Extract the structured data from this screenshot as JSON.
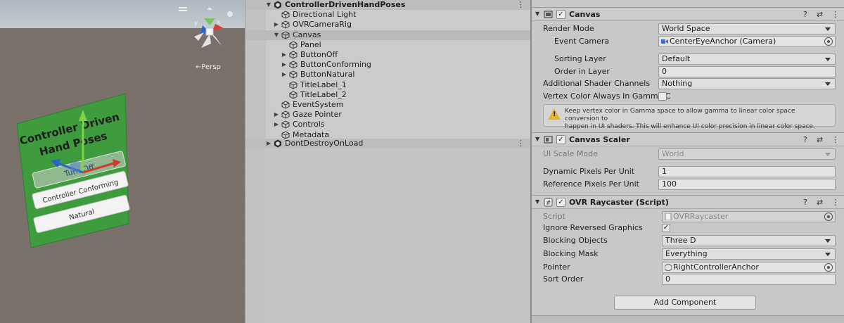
{
  "scene": {
    "persp_label": "←Persp",
    "panel": {
      "title_line1": "Controller Driven",
      "title_line2": "Hand Poses",
      "button_off": "Turn Off",
      "button_conforming": "Controller Conforming",
      "button_natural": "Natural"
    },
    "colors": {
      "ground": "#7a706a",
      "sky": "#b9c2cc",
      "panel": "#3a9a3a"
    }
  },
  "hierarchy": {
    "items": [
      {
        "label": "ControllerDrivenHandPoses",
        "depth": 0,
        "arrow": "down",
        "icon": "unity-scene-icon",
        "bold": true,
        "kebab": "⋮"
      },
      {
        "label": "Directional Light",
        "depth": 1,
        "arrow": "",
        "icon": "gameobject-icon"
      },
      {
        "label": "OVRCameraRig",
        "depth": 1,
        "arrow": "right",
        "icon": "gameobject-icon"
      },
      {
        "label": "Canvas",
        "depth": 1,
        "arrow": "down",
        "icon": "gameobject-icon",
        "selected": true
      },
      {
        "label": "Panel",
        "depth": 2,
        "arrow": "",
        "icon": "gameobject-icon"
      },
      {
        "label": "ButtonOff",
        "depth": 2,
        "arrow": "right",
        "icon": "gameobject-icon"
      },
      {
        "label": "ButtonConforming",
        "depth": 2,
        "arrow": "right",
        "icon": "gameobject-icon"
      },
      {
        "label": "ButtonNatural",
        "depth": 2,
        "arrow": "right",
        "icon": "gameobject-icon"
      },
      {
        "label": "TitleLabel_1",
        "depth": 2,
        "arrow": "",
        "icon": "gameobject-icon"
      },
      {
        "label": "TitleLabel_2",
        "depth": 2,
        "arrow": "",
        "icon": "gameobject-icon"
      },
      {
        "label": "EventSystem",
        "depth": 1,
        "arrow": "",
        "icon": "gameobject-icon"
      },
      {
        "label": "Gaze Pointer",
        "depth": 1,
        "arrow": "right",
        "icon": "gameobject-icon"
      },
      {
        "label": "Controls",
        "depth": 1,
        "arrow": "right",
        "icon": "gameobject-icon"
      },
      {
        "label": "Metadata",
        "depth": 1,
        "arrow": "",
        "icon": "gameobject-icon"
      },
      {
        "label": "DontDestroyOnLoad",
        "depth": 0,
        "arrow": "right",
        "icon": "unity-scene-icon",
        "kebab": "⋮"
      }
    ]
  },
  "inspector": {
    "canvas": {
      "title": "Canvas",
      "enabled": "✓",
      "render_mode_label": "Render Mode",
      "render_mode_value": "World Space",
      "event_camera_label": "Event Camera",
      "event_camera_value": "CenterEyeAnchor (Camera)",
      "sorting_layer_label": "Sorting Layer",
      "sorting_layer_value": "Default",
      "order_in_layer_label": "Order in Layer",
      "order_in_layer_value": "0",
      "shader_channels_label": "Additional Shader Channels",
      "shader_channels_value": "Nothing",
      "vertex_color_label": "Vertex Color Always In Gamma C",
      "help_line1": "Keep vertex color in Gamma space to allow gamma to linear color space conversion to",
      "help_line2": "happen in UI shaders. This will enhance UI color precision in linear color space."
    },
    "canvas_scaler": {
      "title": "Canvas Scaler",
      "enabled": "✓",
      "ui_scale_mode_label": "UI Scale Mode",
      "ui_scale_mode_value": "World",
      "dynamic_ppu_label": "Dynamic Pixels Per Unit",
      "dynamic_ppu_value": "1",
      "reference_ppu_label": "Reference Pixels Per Unit",
      "reference_ppu_value": "100"
    },
    "ovr_raycaster": {
      "title": "OVR Raycaster (Script)",
      "enabled": "✓",
      "script_label": "Script",
      "script_value": "OVRRaycaster",
      "ignore_reversed_label": "Ignore Reversed Graphics",
      "ignore_reversed_value": "✓",
      "blocking_objects_label": "Blocking Objects",
      "blocking_objects_value": "Three D",
      "blocking_mask_label": "Blocking Mask",
      "blocking_mask_value": "Everything",
      "pointer_label": "Pointer",
      "pointer_value": "RightControllerAnchor",
      "sort_order_label": "Sort Order",
      "sort_order_value": "0"
    },
    "add_component_label": "Add Component",
    "header_icons": {
      "help": "?",
      "presets": "⇄",
      "menu": "⋮"
    }
  }
}
